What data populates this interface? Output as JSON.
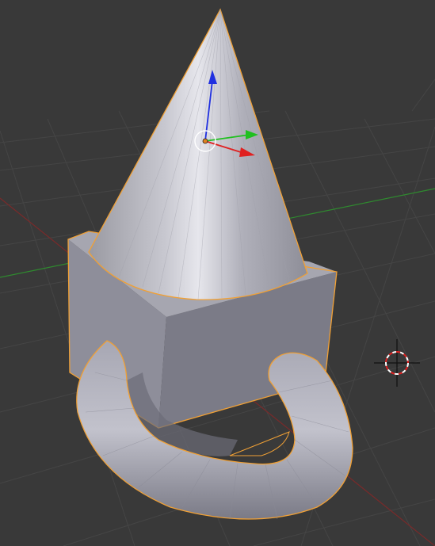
{
  "viewport": {
    "background": "#393939",
    "grid_color": "#4a4a4a",
    "x_axis_color": "#7a2a2a",
    "y_axis_color": "#2f8a2f",
    "selection_outline_color": "#f0a035"
  },
  "scene": {
    "objects": [
      {
        "name": "cone",
        "selected": true,
        "color": "#b8b8c2"
      },
      {
        "name": "cube",
        "selected": true,
        "color": "#9c9ca8"
      },
      {
        "name": "torus-half",
        "selected": true,
        "color": "#a9a9b6"
      }
    ]
  },
  "gizmo": {
    "x_axis_color": "#e02020",
    "y_axis_color": "#20c020",
    "z_axis_color": "#2030e0",
    "center_color": "#e08020"
  },
  "cursor_3d": {
    "ring_color_a": "#ffffff",
    "ring_color_b": "#e02020"
  }
}
